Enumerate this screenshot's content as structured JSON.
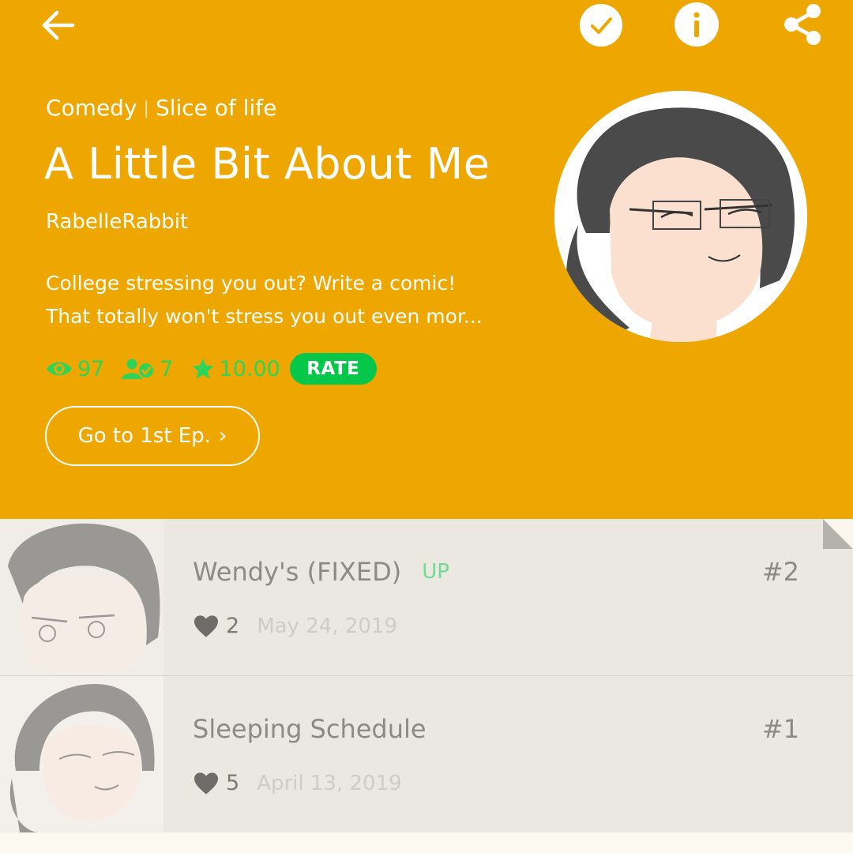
{
  "header": {
    "genres": [
      "Comedy",
      "Slice of life"
    ],
    "genre_separator": "|",
    "title": "A Little Bit About Me",
    "author": "RabelleRabbit",
    "description_lines": [
      "College stressing you out? Write a comic!",
      "That totally won't stress you out even mor..."
    ],
    "stats": {
      "views": "97",
      "subscribers": "7",
      "rating": "10.00"
    },
    "rate_label": "RATE",
    "first_ep_label": "Go to 1st Ep."
  },
  "toolbar": {
    "icons": [
      "back-arrow-icon",
      "check-icon",
      "info-icon",
      "share-icon"
    ]
  },
  "episodes": [
    {
      "title": "Wendy's (FIXED)",
      "badge": "UP",
      "number": "#2",
      "likes": "2",
      "date": "May 24, 2019"
    },
    {
      "title": "Sleeping Schedule",
      "badge": "",
      "number": "#1",
      "likes": "5",
      "date": "April 13, 2019"
    }
  ],
  "colors": {
    "header_bg": "#eea700",
    "accent_green": "#2ed35a",
    "rate_green": "#05c84a",
    "episode_bg": "#ebe7e1"
  }
}
